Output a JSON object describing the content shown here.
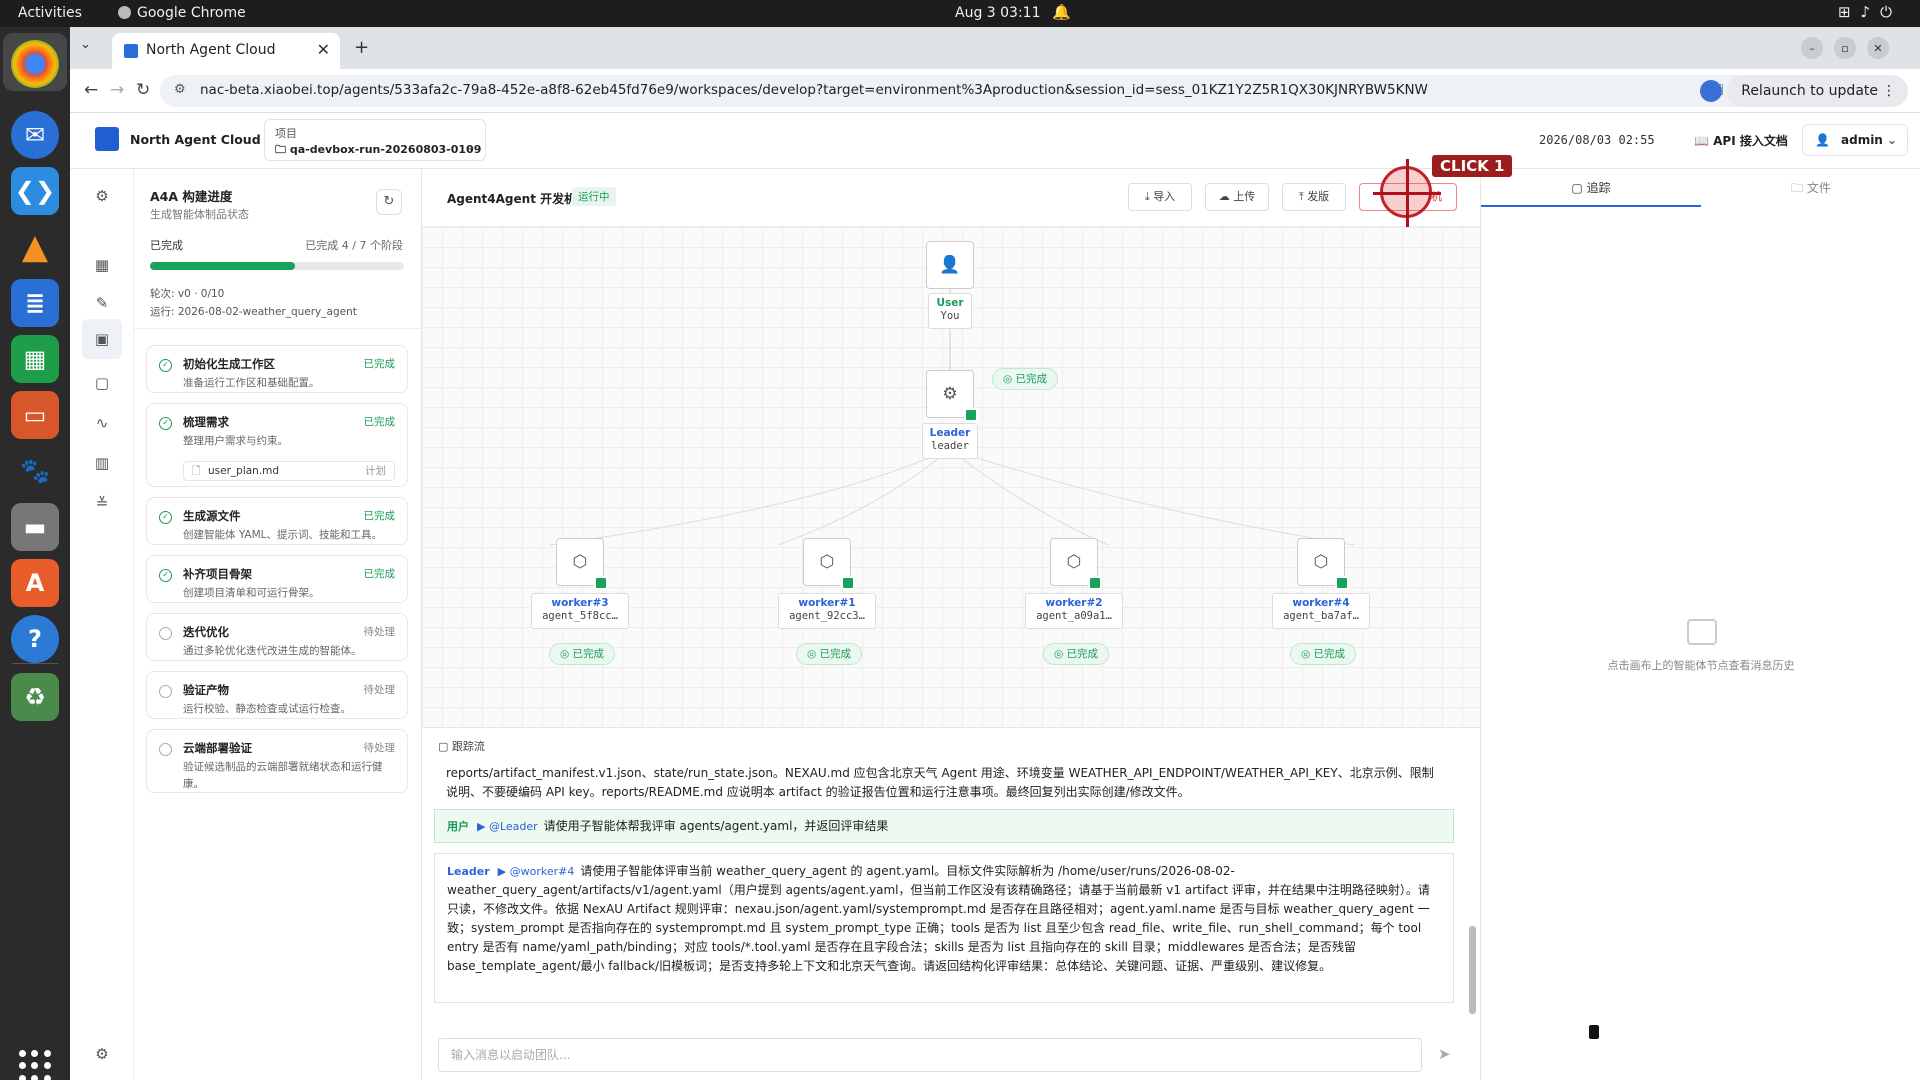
{
  "system": {
    "activities": "Activities",
    "app": "Google Chrome",
    "clock": "Aug 3  03:11"
  },
  "browser": {
    "tab_title": "North Agent Cloud",
    "url": "nac-beta.xiaobei.top/agents/533afa2c-79a8-452e-a8f8-62eb45fd76e9/workspaces/develop?target=environment%3Aproduction&session_id=sess_01KZ1Y2Z5R1QX30KJNRYBW5KNW",
    "relaunch": "Relaunch to update"
  },
  "header": {
    "brand": "North Agent Cloud",
    "project_label": "项目",
    "project_value": "qa-devbox-run-20260803-0109",
    "datetime": "2026/08/03 02:55",
    "api_doc": "API 接入文档",
    "user": "admin"
  },
  "progress": {
    "title": "A4A 构建进度",
    "subtitle": "生成智能体制品状态",
    "done_label": "已完成",
    "stat": "已完成 4 / 7 个阶段",
    "fraction": 0.57,
    "round": "轮次: v0 · 0/10",
    "run": "运行: 2026-08-02-weather_query_agent"
  },
  "stages": [
    {
      "name": "初始化生成工作区",
      "status": "已完成",
      "desc": "准备运行工作区和基础配置。"
    },
    {
      "name": "梳理需求",
      "status": "已完成",
      "desc": "整理用户需求与约束。",
      "file": "user_plan.md",
      "file_tag": "计划"
    },
    {
      "name": "生成源文件",
      "status": "已完成",
      "desc": "创建智能体 YAML、提示词、技能和工具。"
    },
    {
      "name": "补齐项目骨架",
      "status": "已完成",
      "desc": "创建项目清单和可运行骨架。"
    },
    {
      "name": "迭代优化",
      "status": "待处理",
      "desc": "通过多轮优化迭代改进生成的智能体。"
    },
    {
      "name": "验证产物",
      "status": "待处理",
      "desc": "运行校验、静态检查或试运行检查。"
    },
    {
      "name": "云端部署验证",
      "status": "待处理",
      "desc": "验证候选制品的云端部署就绪状态和运行健康。"
    }
  ],
  "workspace": {
    "title": "Agent4Agent 开发机",
    "status": "运行中",
    "btn_import": "导入",
    "btn_upload": "上传",
    "btn_publish": "发版",
    "btn_shutdown": "机"
  },
  "graph": {
    "user": {
      "name": "User",
      "id": "You"
    },
    "leader": {
      "name": "Leader",
      "id": "leader",
      "status": "已完成"
    },
    "workers": [
      {
        "name": "worker#3",
        "id": "agent_5f8cc…",
        "status": "已完成"
      },
      {
        "name": "worker#1",
        "id": "agent_92cc3…",
        "status": "已完成"
      },
      {
        "name": "worker#2",
        "id": "agent_a09a1…",
        "status": "已完成"
      },
      {
        "name": "worker#4",
        "id": "agent_ba7af…",
        "status": "已完成"
      }
    ]
  },
  "trace": {
    "title": "跟踪流",
    "prev_text": "reports/artifact_manifest.v1.json、state/run_state.json。NEXAU.md 应包含北京天气 Agent 用途、环境变量 WEATHER_API_ENDPOINT/WEATHER_API_KEY、北京示例、限制说明、不要硬编码 API key。reports/README.md 应说明本 artifact 的验证报告位置和运行注意事项。最终回复列出实际创建/修改文件。",
    "user_who": "用户",
    "user_at": "▶ @Leader",
    "user_text": "请使用子智能体帮我评审 agents/agent.yaml，并返回评审结果",
    "leader_who": "Leader",
    "leader_at": "▶ @worker#4",
    "leader_text": "请使用子智能体评审当前 weather_query_agent 的 agent.yaml。目标文件实际解析为 /home/user/runs/2026-08-02-weather_query_agent/artifacts/v1/agent.yaml（用户提到 agents/agent.yaml，但当前工作区没有该精确路径；请基于当前最新 v1 artifact 评审，并在结果中注明路径映射）。请只读，不修改文件。依据 NexAU Artifact 规则评审：nexau.json/agent.yaml/systemprompt.md 是否存在且路径相对；agent.yaml.name 是否与目标 weather_query_agent 一致；system_prompt 是否指向存在的 systemprompt.md 且 system_prompt_type 正确；tools 是否为 list 且至少包含 read_file、write_file、run_shell_command；每个 tool entry 是否有 name/yaml_path/binding；对应 tools/*.tool.yaml 是否存在且字段合法；skills 是否为 list 且指向存在的 skill 目录；middlewares 是否合法；是否残留 base_template_agent/最小 fallback/旧模板词；是否支持多轮上下文和北京天气查询。请返回结构化评审结果：总体结论、关键问题、证据、严重级别、建议修复。",
    "input_placeholder": "输入消息以启动团队..."
  },
  "right_panel": {
    "tab_trace": "追踪",
    "tab_files": "文件",
    "empty": "点击画布上的智能体节点查看消息历史"
  },
  "overlay": {
    "click_label": "CLICK 1"
  }
}
